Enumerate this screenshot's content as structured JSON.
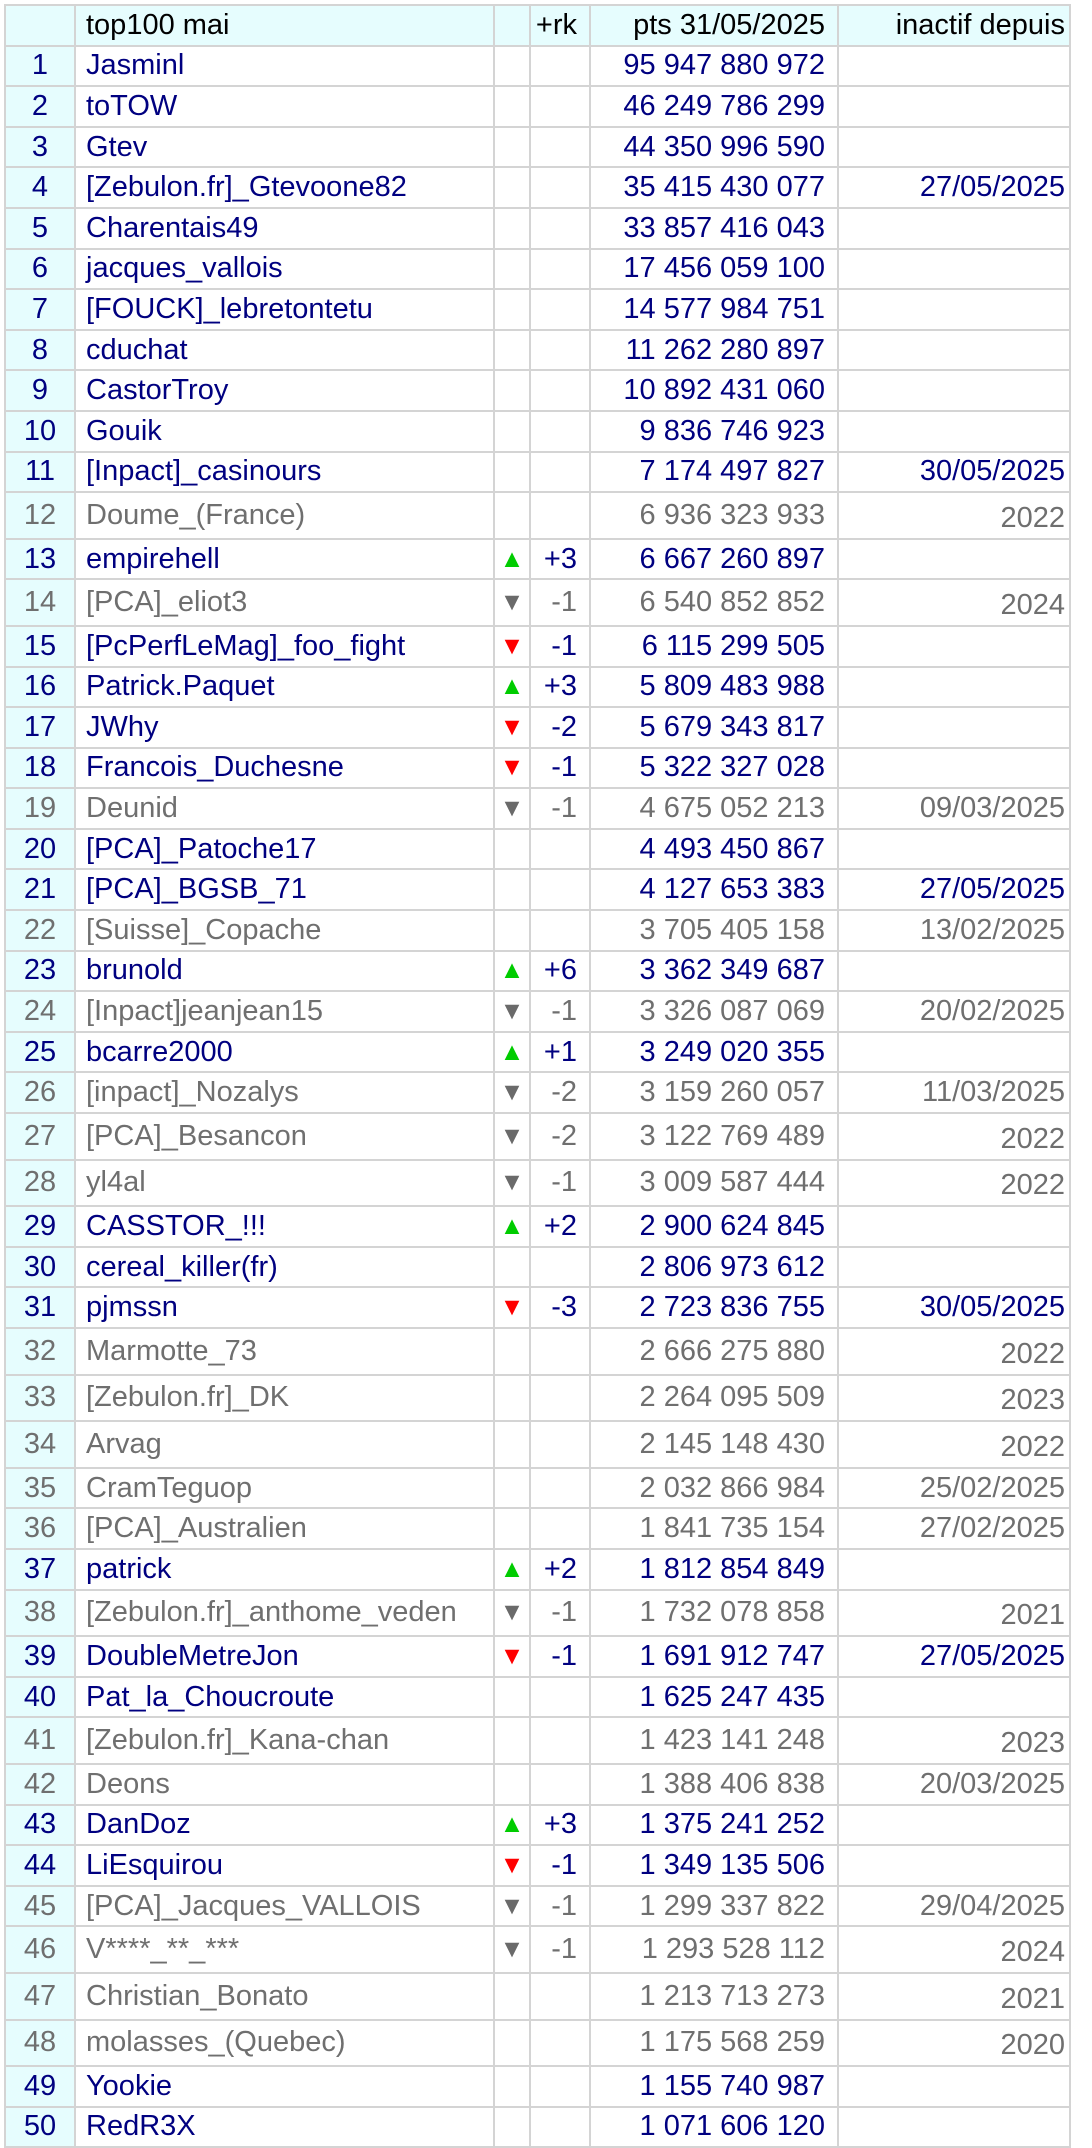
{
  "header": {
    "rank": "",
    "name": "top100 mai",
    "delta": "+rk",
    "points": "pts 31/05/2025",
    "inactive": "inactif depuis"
  },
  "colors": {
    "active_text": "#000080",
    "inactive_text": "#6f6f6f",
    "header_bg": "#e6fdfe",
    "arrow_up": "#00cc00",
    "arrow_down": "#ff0000",
    "arrow_down_inactive": "#6a6a6a"
  },
  "rows": [
    {
      "rank": "1",
      "name": "Jasminl",
      "arrow": "",
      "delta": "",
      "points": "95 947 880 972",
      "inactive": "",
      "status": "active"
    },
    {
      "rank": "2",
      "name": "toTOW",
      "arrow": "",
      "delta": "",
      "points": "46 249 786 299",
      "inactive": "",
      "status": "active"
    },
    {
      "rank": "3",
      "name": "Gtev",
      "arrow": "",
      "delta": "",
      "points": "44 350 996 590",
      "inactive": "",
      "status": "active"
    },
    {
      "rank": "4",
      "name": "[Zebulon.fr]_Gtevoone82",
      "arrow": "",
      "delta": "",
      "points": "35 415 430 077",
      "inactive": "27/05/2025",
      "status": "active"
    },
    {
      "rank": "5",
      "name": "Charentais49",
      "arrow": "",
      "delta": "",
      "points": "33 857 416 043",
      "inactive": "",
      "status": "active"
    },
    {
      "rank": "6",
      "name": "jacques_vallois",
      "arrow": "",
      "delta": "",
      "points": "17 456 059 100",
      "inactive": "",
      "status": "active"
    },
    {
      "rank": "7",
      "name": "[FOUCK]_lebretontetu",
      "arrow": "",
      "delta": "",
      "points": "14 577 984 751",
      "inactive": "",
      "status": "active"
    },
    {
      "rank": "8",
      "name": "cduchat",
      "arrow": "",
      "delta": "",
      "points": "11 262 280 897",
      "inactive": "",
      "status": "active"
    },
    {
      "rank": "9",
      "name": "CastorTroy",
      "arrow": "",
      "delta": "",
      "points": "10 892 431 060",
      "inactive": "",
      "status": "active"
    },
    {
      "rank": "10",
      "name": "Gouik",
      "arrow": "",
      "delta": "",
      "points": "9 836 746 923",
      "inactive": "",
      "status": "active"
    },
    {
      "rank": "11",
      "name": "[Inpact]_casinours",
      "arrow": "",
      "delta": "",
      "points": "7 174 497 827",
      "inactive": "30/05/2025",
      "status": "active"
    },
    {
      "rank": "12",
      "name": "Doume_(France)",
      "arrow": "",
      "delta": "",
      "points": "6 936 323 933",
      "inactive": "2022",
      "status": "dim"
    },
    {
      "rank": "13",
      "name": "empirehell",
      "arrow": "up",
      "delta": "+3",
      "points": "6 667 260 897",
      "inactive": "",
      "status": "active"
    },
    {
      "rank": "14",
      "name": "[PCA]_eliot3",
      "arrow": "down",
      "delta": "-1",
      "points": "6 540 852 852",
      "inactive": "2024",
      "status": "dim"
    },
    {
      "rank": "15",
      "name": "[PcPerfLeMag]_foo_fight",
      "arrow": "down",
      "delta": "-1",
      "points": "6 115 299 505",
      "inactive": "",
      "status": "active"
    },
    {
      "rank": "16",
      "name": "Patrick.Paquet",
      "arrow": "up",
      "delta": "+3",
      "points": "5 809 483 988",
      "inactive": "",
      "status": "active"
    },
    {
      "rank": "17",
      "name": "JWhy",
      "arrow": "down",
      "delta": "-2",
      "points": "5 679 343 817",
      "inactive": "",
      "status": "active"
    },
    {
      "rank": "18",
      "name": "Francois_Duchesne",
      "arrow": "down",
      "delta": "-1",
      "points": "5 322 327 028",
      "inactive": "",
      "status": "active"
    },
    {
      "rank": "19",
      "name": "Deunid",
      "arrow": "down",
      "delta": "-1",
      "points": "4 675 052 213",
      "inactive": "09/03/2025",
      "status": "dim"
    },
    {
      "rank": "20",
      "name": "[PCA]_Patoche17",
      "arrow": "",
      "delta": "",
      "points": "4 493 450 867",
      "inactive": "",
      "status": "active"
    },
    {
      "rank": "21",
      "name": "[PCA]_BGSB_71",
      "arrow": "",
      "delta": "",
      "points": "4 127 653 383",
      "inactive": "27/05/2025",
      "status": "active"
    },
    {
      "rank": "22",
      "name": "[Suisse]_Copache",
      "arrow": "",
      "delta": "",
      "points": "3 705 405 158",
      "inactive": "13/02/2025",
      "status": "dim"
    },
    {
      "rank": "23",
      "name": "brunold",
      "arrow": "up",
      "delta": "+6",
      "points": "3 362 349 687",
      "inactive": "",
      "status": "active"
    },
    {
      "rank": "24",
      "name": "[Inpact]jeanjean15",
      "arrow": "down",
      "delta": "-1",
      "points": "3 326 087 069",
      "inactive": "20/02/2025",
      "status": "dim"
    },
    {
      "rank": "25",
      "name": "bcarre2000",
      "arrow": "up",
      "delta": "+1",
      "points": "3 249 020 355",
      "inactive": "",
      "status": "active"
    },
    {
      "rank": "26",
      "name": "[inpact]_Nozalys",
      "arrow": "down",
      "delta": "-2",
      "points": "3 159 260 057",
      "inactive": "11/03/2025",
      "status": "dim"
    },
    {
      "rank": "27",
      "name": "[PCA]_Besancon",
      "arrow": "down",
      "delta": "-2",
      "points": "3 122 769 489",
      "inactive": "2022",
      "status": "dim"
    },
    {
      "rank": "28",
      "name": "yl4al",
      "arrow": "down",
      "delta": "-1",
      "points": "3 009 587 444",
      "inactive": "2022",
      "status": "dim"
    },
    {
      "rank": "29",
      "name": "CASSTOR_!!!",
      "arrow": "up",
      "delta": "+2",
      "points": "2 900 624 845",
      "inactive": "",
      "status": "active"
    },
    {
      "rank": "30",
      "name": "cereal_killer(fr)",
      "arrow": "",
      "delta": "",
      "points": "2 806 973 612",
      "inactive": "",
      "status": "active"
    },
    {
      "rank": "31",
      "name": "pjmssn",
      "arrow": "down",
      "delta": "-3",
      "points": "2 723 836 755",
      "inactive": "30/05/2025",
      "status": "active"
    },
    {
      "rank": "32",
      "name": "Marmotte_73",
      "arrow": "",
      "delta": "",
      "points": "2 666 275 880",
      "inactive": "2022",
      "status": "dim"
    },
    {
      "rank": "33",
      "name": "[Zebulon.fr]_DK",
      "arrow": "",
      "delta": "",
      "points": "2 264 095 509",
      "inactive": "2023",
      "status": "dim"
    },
    {
      "rank": "34",
      "name": "Arvag",
      "arrow": "",
      "delta": "",
      "points": "2 145 148 430",
      "inactive": "2022",
      "status": "dim"
    },
    {
      "rank": "35",
      "name": "CramTeguop",
      "arrow": "",
      "delta": "",
      "points": "2 032 866 984",
      "inactive": "25/02/2025",
      "status": "dim"
    },
    {
      "rank": "36",
      "name": "[PCA]_Australien",
      "arrow": "",
      "delta": "",
      "points": "1 841 735 154",
      "inactive": "27/02/2025",
      "status": "dim"
    },
    {
      "rank": "37",
      "name": "patrick",
      "arrow": "up",
      "delta": "+2",
      "points": "1 812 854 849",
      "inactive": "",
      "status": "active"
    },
    {
      "rank": "38",
      "name": "[Zebulon.fr]_anthome_veden",
      "arrow": "down",
      "delta": "-1",
      "points": "1 732 078 858",
      "inactive": "2021",
      "status": "dim"
    },
    {
      "rank": "39",
      "name": "DoubleMetreJon",
      "arrow": "down",
      "delta": "-1",
      "points": "1 691 912 747",
      "inactive": "27/05/2025",
      "status": "active"
    },
    {
      "rank": "40",
      "name": "Pat_la_Choucroute",
      "arrow": "",
      "delta": "",
      "points": "1 625 247 435",
      "inactive": "",
      "status": "active"
    },
    {
      "rank": "41",
      "name": "[Zebulon.fr]_Kana-chan",
      "arrow": "",
      "delta": "",
      "points": "1 423 141 248",
      "inactive": "2023",
      "status": "dim"
    },
    {
      "rank": "42",
      "name": "Deons",
      "arrow": "",
      "delta": "",
      "points": "1 388 406 838",
      "inactive": "20/03/2025",
      "status": "dim"
    },
    {
      "rank": "43",
      "name": "DanDoz",
      "arrow": "up",
      "delta": "+3",
      "points": "1 375 241 252",
      "inactive": "",
      "status": "active"
    },
    {
      "rank": "44",
      "name": "LiEsquirou",
      "arrow": "down",
      "delta": "-1",
      "points": "1 349 135 506",
      "inactive": "",
      "status": "active"
    },
    {
      "rank": "45",
      "name": "[PCA]_Jacques_VALLOIS",
      "arrow": "down",
      "delta": "-1",
      "points": "1 299 337 822",
      "inactive": "29/04/2025",
      "status": "dim"
    },
    {
      "rank": "46",
      "name": "V****_**_***",
      "arrow": "down",
      "delta": "-1",
      "points": "1 293 528 112",
      "inactive": "2024",
      "status": "dim"
    },
    {
      "rank": "47",
      "name": "Christian_Bonato",
      "arrow": "",
      "delta": "",
      "points": "1 213 713 273",
      "inactive": "2021",
      "status": "dim"
    },
    {
      "rank": "48",
      "name": "molasses_(Quebec)",
      "arrow": "",
      "delta": "",
      "points": "1 175 568 259",
      "inactive": "2020",
      "status": "dim"
    },
    {
      "rank": "49",
      "name": "Yookie",
      "arrow": "",
      "delta": "",
      "points": "1 155 740 987",
      "inactive": "",
      "status": "active"
    },
    {
      "rank": "50",
      "name": "RedR3X",
      "arrow": "",
      "delta": "",
      "points": "1 071 606 120",
      "inactive": "",
      "status": "active"
    }
  ]
}
